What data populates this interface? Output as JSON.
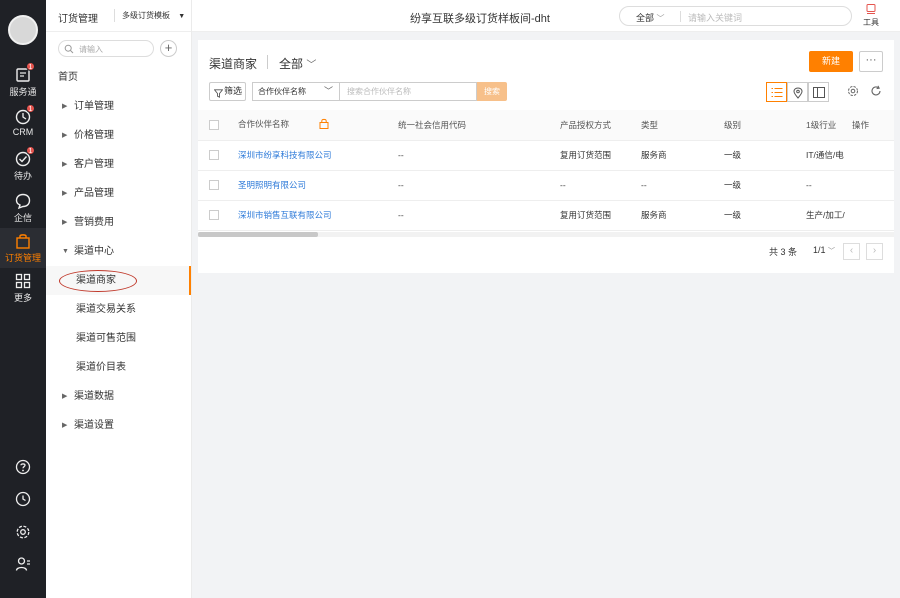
{
  "rail": {
    "items": [
      {
        "label": "服务通",
        "icon": "service-icon",
        "badge": "1"
      },
      {
        "label": "CRM",
        "icon": "crm-icon",
        "badge": "1"
      },
      {
        "label": "待办",
        "icon": "todo-icon",
        "badge": "1"
      },
      {
        "label": "企信",
        "icon": "chat-icon"
      },
      {
        "label": "订货管理",
        "icon": "order-bag-icon",
        "active": true
      },
      {
        "label": "更多",
        "icon": "grid-icon"
      }
    ],
    "bottom_icons": [
      "help-icon",
      "history-icon",
      "settings-icon",
      "user-icon"
    ]
  },
  "sidebar": {
    "app_name": "订货管理",
    "template_select": "多级订货模板",
    "search_placeholder": "请输入",
    "home": "首页",
    "items": [
      {
        "label": "订单管理"
      },
      {
        "label": "价格管理"
      },
      {
        "label": "客户管理"
      },
      {
        "label": "产品管理"
      },
      {
        "label": "营销费用"
      }
    ],
    "channel_center": {
      "label": "渠道中心",
      "children": [
        "渠道商家",
        "渠道交易关系",
        "渠道可售范围",
        "渠道价目表"
      ]
    },
    "after_items": [
      {
        "label": "渠道数据"
      },
      {
        "label": "渠道设置"
      }
    ]
  },
  "header": {
    "title": "纷享互联多级订货样板间-dht",
    "search_scope": "全部",
    "search_placeholder": "请输入关键词",
    "tools_label": "工具"
  },
  "page": {
    "title": "渠道商家",
    "scope": "全部",
    "new_button": "新建",
    "more_button": "···",
    "filter_button": "筛选",
    "field_select": "合作伙伴名称",
    "field_placeholder": "搜索合作伙伴名称",
    "search_button": "搜索"
  },
  "table": {
    "columns": [
      "合作伙伴名称",
      "统一社会信用代码",
      "产品授权方式",
      "类型",
      "级别",
      "1级行业",
      "操作"
    ],
    "rows": [
      [
        "深圳市纷享科技有限公司",
        "--",
        "复用订货范围",
        "服务商",
        "一级",
        "IT/通信/电",
        ""
      ],
      [
        "圣明照明有限公司",
        "--",
        "--",
        "--",
        "一级",
        "--",
        ""
      ],
      [
        "深圳市销售互联有限公司",
        "--",
        "复用订货范围",
        "服务商",
        "一级",
        "生产/加工/",
        ""
      ]
    ]
  },
  "pagination": {
    "total": "共 3 条",
    "page": "1/1"
  },
  "colors": {
    "accent": "#ff8000",
    "rail_bg": "#1f2126",
    "link": "#2f7bd9",
    "annotation_circle": "#c0392b"
  }
}
